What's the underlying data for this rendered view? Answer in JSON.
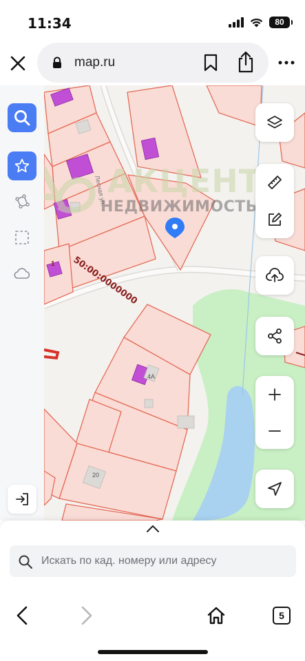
{
  "status_bar": {
    "time": "11:34",
    "battery": "80"
  },
  "browser": {
    "url": "map.ru",
    "icons": [
      "close-icon",
      "lock-icon",
      "bookmark-icon",
      "share-icon",
      "more-icon"
    ]
  },
  "watermark": {
    "brand": "АКЦЕНТ",
    "subtitle": "НЕДВИЖИМОСТЬ"
  },
  "map": {
    "cadastral_label": "50:00:0000000",
    "street_label": "Лесная ул.",
    "house_numbers": [
      "20",
      "4A"
    ],
    "lot_tag": "1"
  },
  "left_toolbar": {
    "items": [
      "search-tool",
      "favorites-tool",
      "polygon-tool",
      "select-area-tool",
      "cloud-tool",
      "exit-tool"
    ]
  },
  "right_toolbar": {
    "items": [
      "layers",
      "ruler",
      "edit",
      "upload",
      "share",
      "zoom-in",
      "zoom-out",
      "locate"
    ]
  },
  "search": {
    "placeholder": "Искать по кад. номеру или адресу"
  },
  "bottom_nav": {
    "tabs_count": "5"
  },
  "colors": {
    "accent": "#4a7cf3",
    "parcel_fill": "#fadcd6",
    "parcel_border": "#e46a56",
    "building": "#c14fd6",
    "water": "#a8d2f0",
    "greenery": "#c9efc4"
  }
}
